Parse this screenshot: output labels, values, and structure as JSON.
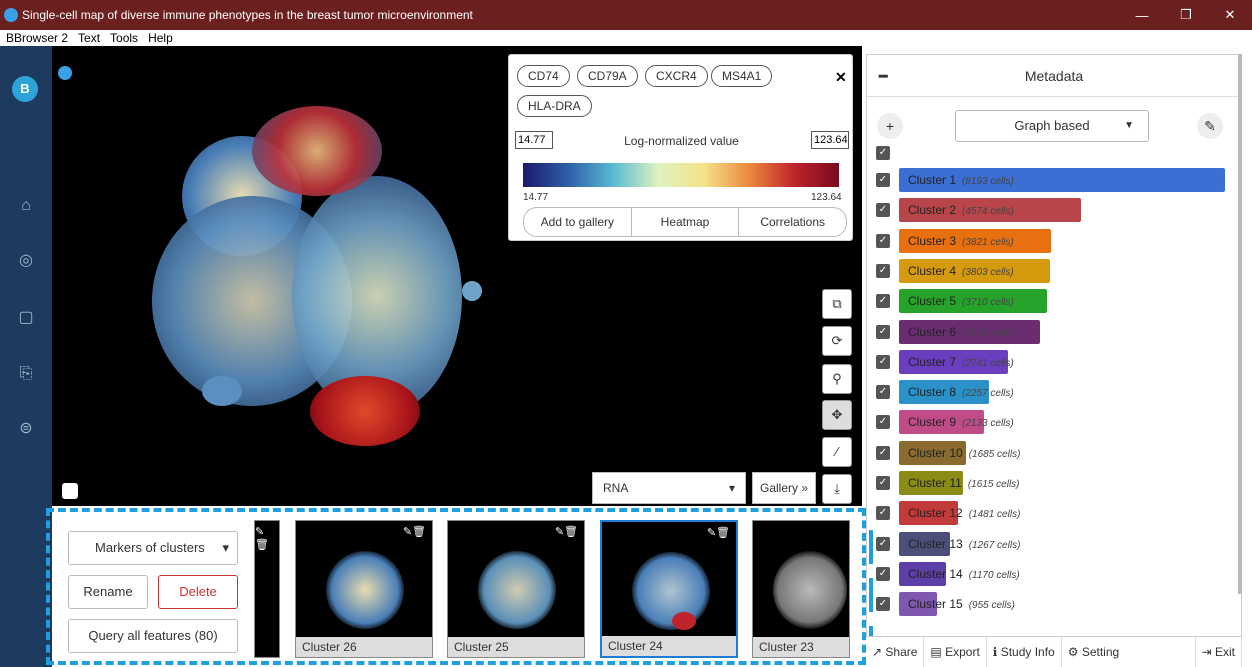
{
  "window": {
    "title": "Single-cell map of diverse immune phenotypes in the breast tumor microenvironment",
    "controls": [
      "—",
      "❐",
      "✕"
    ]
  },
  "menu": [
    "BBrowser 2",
    "Text",
    "Tools",
    "Help"
  ],
  "sidebar": {
    "logo": "B",
    "icons": [
      "home-icon",
      "lifebuoy-icon",
      "folder-icon",
      "file-upload-icon",
      "settings-icon"
    ]
  },
  "legend": {
    "tags": [
      "CD74",
      "CD79A",
      "CXCR4",
      "MS4A1",
      "HLA-DRA"
    ],
    "min_input": "14.77",
    "max_input": "123.64",
    "label": "Log-normalized value",
    "min_label": "14.77",
    "max_label": "123.64",
    "buttons": [
      "Add to gallery",
      "Heatmap",
      "Correlations"
    ]
  },
  "viewer": {
    "data_select": "RNA",
    "gallery_button": "Gallery »"
  },
  "gallery": {
    "marker_select": "Markers of clusters",
    "rename": "Rename",
    "delete": "Delete",
    "query_all": "Query all features (80)",
    "thumbs": [
      "Cluster 26",
      "Cluster 25",
      "Cluster 24",
      "Cluster 23"
    ]
  },
  "metadata": {
    "title": "Metadata",
    "group_select": "Graph based",
    "clusters": [
      {
        "name": "Cluster 1",
        "cells": "(8193 cells)",
        "color": "#3b6fd4",
        "frac": 1.0
      },
      {
        "name": "Cluster 2",
        "cells": "(4574 cells)",
        "color": "#b8454a",
        "frac": 0.558
      },
      {
        "name": "Cluster 3",
        "cells": "(3821 cells)",
        "color": "#e8700f",
        "frac": 0.466
      },
      {
        "name": "Cluster 4",
        "cells": "(3803 cells)",
        "color": "#d69a0f",
        "frac": 0.464
      },
      {
        "name": "Cluster 5",
        "cells": "(3710 cells)",
        "color": "#26a32a",
        "frac": 0.453
      },
      {
        "name": "Cluster 6",
        "cells": "(3532 cells)",
        "color": "#6b2d72",
        "frac": 0.431
      },
      {
        "name": "Cluster 7",
        "cells": "(2741 cells)",
        "color": "#6a3fbf",
        "frac": 0.335
      },
      {
        "name": "Cluster 8",
        "cells": "(2257 cells)",
        "color": "#2a91c9",
        "frac": 0.275
      },
      {
        "name": "Cluster 9",
        "cells": "(2133 cells)",
        "color": "#c04c87",
        "frac": 0.26
      },
      {
        "name": "Cluster 10",
        "cells": "(1685 cells)",
        "color": "#8a6a2e",
        "frac": 0.206
      },
      {
        "name": "Cluster 11",
        "cells": "(1615 cells)",
        "color": "#8a8c16",
        "frac": 0.197
      },
      {
        "name": "Cluster 12",
        "cells": "(1481 cells)",
        "color": "#c23a3a",
        "frac": 0.181
      },
      {
        "name": "Cluster 13",
        "cells": "(1267 cells)",
        "color": "#4c4f7a",
        "frac": 0.155
      },
      {
        "name": "Cluster 14",
        "cells": "(1170 cells)",
        "color": "#5e3fa8",
        "frac": 0.143
      },
      {
        "name": "Cluster 15",
        "cells": "(955 cells)",
        "color": "#7e57b0",
        "frac": 0.117
      }
    ]
  },
  "footer": [
    "Share",
    "Export",
    "Study Info",
    "Setting",
    "Exit"
  ]
}
